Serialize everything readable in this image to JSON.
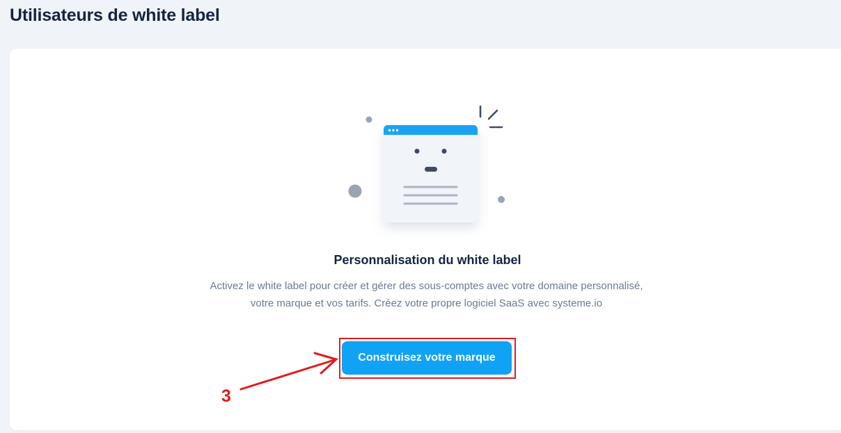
{
  "page": {
    "title": "Utilisateurs de white label"
  },
  "empty_state": {
    "illustration_icon": "browser-window-illustration",
    "title": "Personnalisation du white label",
    "description": "Activez le white label pour créer et gérer des sous-comptes avec votre domaine personnalisé, votre marque et vos tarifs. Créez votre propre logiciel SaaS avec systeme.io",
    "cta_label": "Construisez votre marque"
  },
  "annotation": {
    "step_number": "3",
    "color": "#e01b1b"
  },
  "colors": {
    "background": "#f0f3f8",
    "card": "#ffffff",
    "heading": "#15243f",
    "body_text": "#6b7a90",
    "accent": "#10a2f5"
  }
}
